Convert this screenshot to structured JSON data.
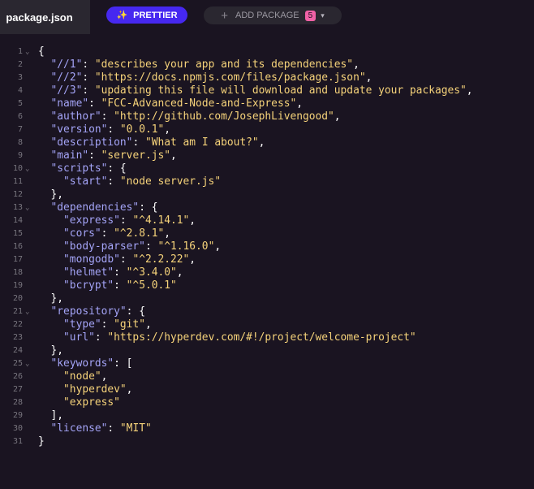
{
  "tab": {
    "filename": "package.json"
  },
  "toolbar": {
    "prettier_label": "PRETTIER",
    "prettier_icon": "sparkle-icon",
    "add_package_label": "ADD PACKAGE",
    "add_package_icon": "plus-icon",
    "add_package_count": "5",
    "chevron_icon": "chevron-down-icon"
  },
  "colors": {
    "background": "#1a1421",
    "tab_active": "#2a2730",
    "prettier_button": "#4628f0",
    "badge": "#f061a6",
    "json_key": "#a4a4f7",
    "json_string": "#f6d37a"
  },
  "editor": {
    "fold_marker": "⌄",
    "lines": [
      {
        "n": "1",
        "fold": true,
        "indent": 0,
        "parts": [
          [
            "p",
            "{"
          ]
        ]
      },
      {
        "n": "2",
        "indent": 1,
        "parts": [
          [
            "k",
            "\"//1\""
          ],
          [
            "p",
            ": "
          ],
          [
            "s",
            "\"describes your app and its dependencies\""
          ],
          [
            "p",
            ","
          ]
        ]
      },
      {
        "n": "3",
        "indent": 1,
        "parts": [
          [
            "k",
            "\"//2\""
          ],
          [
            "p",
            ": "
          ],
          [
            "s",
            "\"https://docs.npmjs.com/files/package.json\""
          ],
          [
            "p",
            ","
          ]
        ]
      },
      {
        "n": "4",
        "indent": 1,
        "parts": [
          [
            "k",
            "\"//3\""
          ],
          [
            "p",
            ": "
          ],
          [
            "s",
            "\"updating this file will download and update your packages\""
          ],
          [
            "p",
            ","
          ]
        ]
      },
      {
        "n": "5",
        "indent": 1,
        "parts": [
          [
            "k",
            "\"name\""
          ],
          [
            "p",
            ": "
          ],
          [
            "s",
            "\"FCC-Advanced-Node-and-Express\""
          ],
          [
            "p",
            ","
          ]
        ]
      },
      {
        "n": "6",
        "indent": 1,
        "parts": [
          [
            "k",
            "\"author\""
          ],
          [
            "p",
            ": "
          ],
          [
            "s",
            "\"http://github.com/JosephLivengood\""
          ],
          [
            "p",
            ","
          ]
        ]
      },
      {
        "n": "7",
        "indent": 1,
        "parts": [
          [
            "k",
            "\"version\""
          ],
          [
            "p",
            ": "
          ],
          [
            "s",
            "\"0.0.1\""
          ],
          [
            "p",
            ","
          ]
        ]
      },
      {
        "n": "8",
        "indent": 1,
        "parts": [
          [
            "k",
            "\"description\""
          ],
          [
            "p",
            ": "
          ],
          [
            "s",
            "\"What am I about?\""
          ],
          [
            "p",
            ","
          ]
        ]
      },
      {
        "n": "9",
        "indent": 1,
        "parts": [
          [
            "k",
            "\"main\""
          ],
          [
            "p",
            ": "
          ],
          [
            "s",
            "\"server.js\""
          ],
          [
            "p",
            ","
          ]
        ]
      },
      {
        "n": "10",
        "fold": true,
        "indent": 1,
        "parts": [
          [
            "k",
            "\"scripts\""
          ],
          [
            "p",
            ": {"
          ]
        ]
      },
      {
        "n": "11",
        "indent": 2,
        "parts": [
          [
            "k",
            "\"start\""
          ],
          [
            "p",
            ": "
          ],
          [
            "s",
            "\"node server.js\""
          ]
        ]
      },
      {
        "n": "12",
        "indent": 1,
        "parts": [
          [
            "p",
            "},"
          ]
        ]
      },
      {
        "n": "13",
        "fold": true,
        "indent": 1,
        "parts": [
          [
            "k",
            "\"dependencies\""
          ],
          [
            "p",
            ": {"
          ]
        ]
      },
      {
        "n": "14",
        "indent": 2,
        "parts": [
          [
            "k",
            "\"express\""
          ],
          [
            "p",
            ": "
          ],
          [
            "s",
            "\"^4.14.1\""
          ],
          [
            "p",
            ","
          ]
        ]
      },
      {
        "n": "15",
        "indent": 2,
        "parts": [
          [
            "k",
            "\"cors\""
          ],
          [
            "p",
            ": "
          ],
          [
            "s",
            "\"^2.8.1\""
          ],
          [
            "p",
            ","
          ]
        ]
      },
      {
        "n": "16",
        "indent": 2,
        "parts": [
          [
            "k",
            "\"body-parser\""
          ],
          [
            "p",
            ": "
          ],
          [
            "s",
            "\"^1.16.0\""
          ],
          [
            "p",
            ","
          ]
        ]
      },
      {
        "n": "17",
        "indent": 2,
        "parts": [
          [
            "k",
            "\"mongodb\""
          ],
          [
            "p",
            ": "
          ],
          [
            "s",
            "\"^2.2.22\""
          ],
          [
            "p",
            ","
          ]
        ]
      },
      {
        "n": "18",
        "indent": 2,
        "parts": [
          [
            "k",
            "\"helmet\""
          ],
          [
            "p",
            ": "
          ],
          [
            "s",
            "\"^3.4.0\""
          ],
          [
            "p",
            ","
          ]
        ]
      },
      {
        "n": "19",
        "indent": 2,
        "parts": [
          [
            "k",
            "\"bcrypt\""
          ],
          [
            "p",
            ": "
          ],
          [
            "s",
            "\"^5.0.1\""
          ]
        ]
      },
      {
        "n": "20",
        "indent": 1,
        "parts": [
          [
            "p",
            "},"
          ]
        ]
      },
      {
        "n": "21",
        "fold": true,
        "indent": 1,
        "parts": [
          [
            "k",
            "\"repository\""
          ],
          [
            "p",
            ": {"
          ]
        ]
      },
      {
        "n": "22",
        "indent": 2,
        "parts": [
          [
            "k",
            "\"type\""
          ],
          [
            "p",
            ": "
          ],
          [
            "s",
            "\"git\""
          ],
          [
            "p",
            ","
          ]
        ]
      },
      {
        "n": "23",
        "indent": 2,
        "parts": [
          [
            "k",
            "\"url\""
          ],
          [
            "p",
            ": "
          ],
          [
            "s",
            "\"https://hyperdev.com/#!/project/welcome-project\""
          ]
        ]
      },
      {
        "n": "24",
        "indent": 1,
        "parts": [
          [
            "p",
            "},"
          ]
        ]
      },
      {
        "n": "25",
        "fold": true,
        "indent": 1,
        "parts": [
          [
            "k",
            "\"keywords\""
          ],
          [
            "p",
            ": ["
          ]
        ]
      },
      {
        "n": "26",
        "indent": 2,
        "parts": [
          [
            "s",
            "\"node\""
          ],
          [
            "p",
            ","
          ]
        ]
      },
      {
        "n": "27",
        "indent": 2,
        "parts": [
          [
            "s",
            "\"hyperdev\""
          ],
          [
            "p",
            ","
          ]
        ]
      },
      {
        "n": "28",
        "indent": 2,
        "parts": [
          [
            "s",
            "\"express\""
          ]
        ]
      },
      {
        "n": "29",
        "indent": 1,
        "parts": [
          [
            "p",
            "],"
          ]
        ]
      },
      {
        "n": "30",
        "indent": 1,
        "parts": [
          [
            "k",
            "\"license\""
          ],
          [
            "p",
            ": "
          ],
          [
            "s",
            "\"MIT\""
          ]
        ]
      },
      {
        "n": "31",
        "indent": 0,
        "parts": [
          [
            "p",
            "}"
          ]
        ]
      }
    ]
  }
}
